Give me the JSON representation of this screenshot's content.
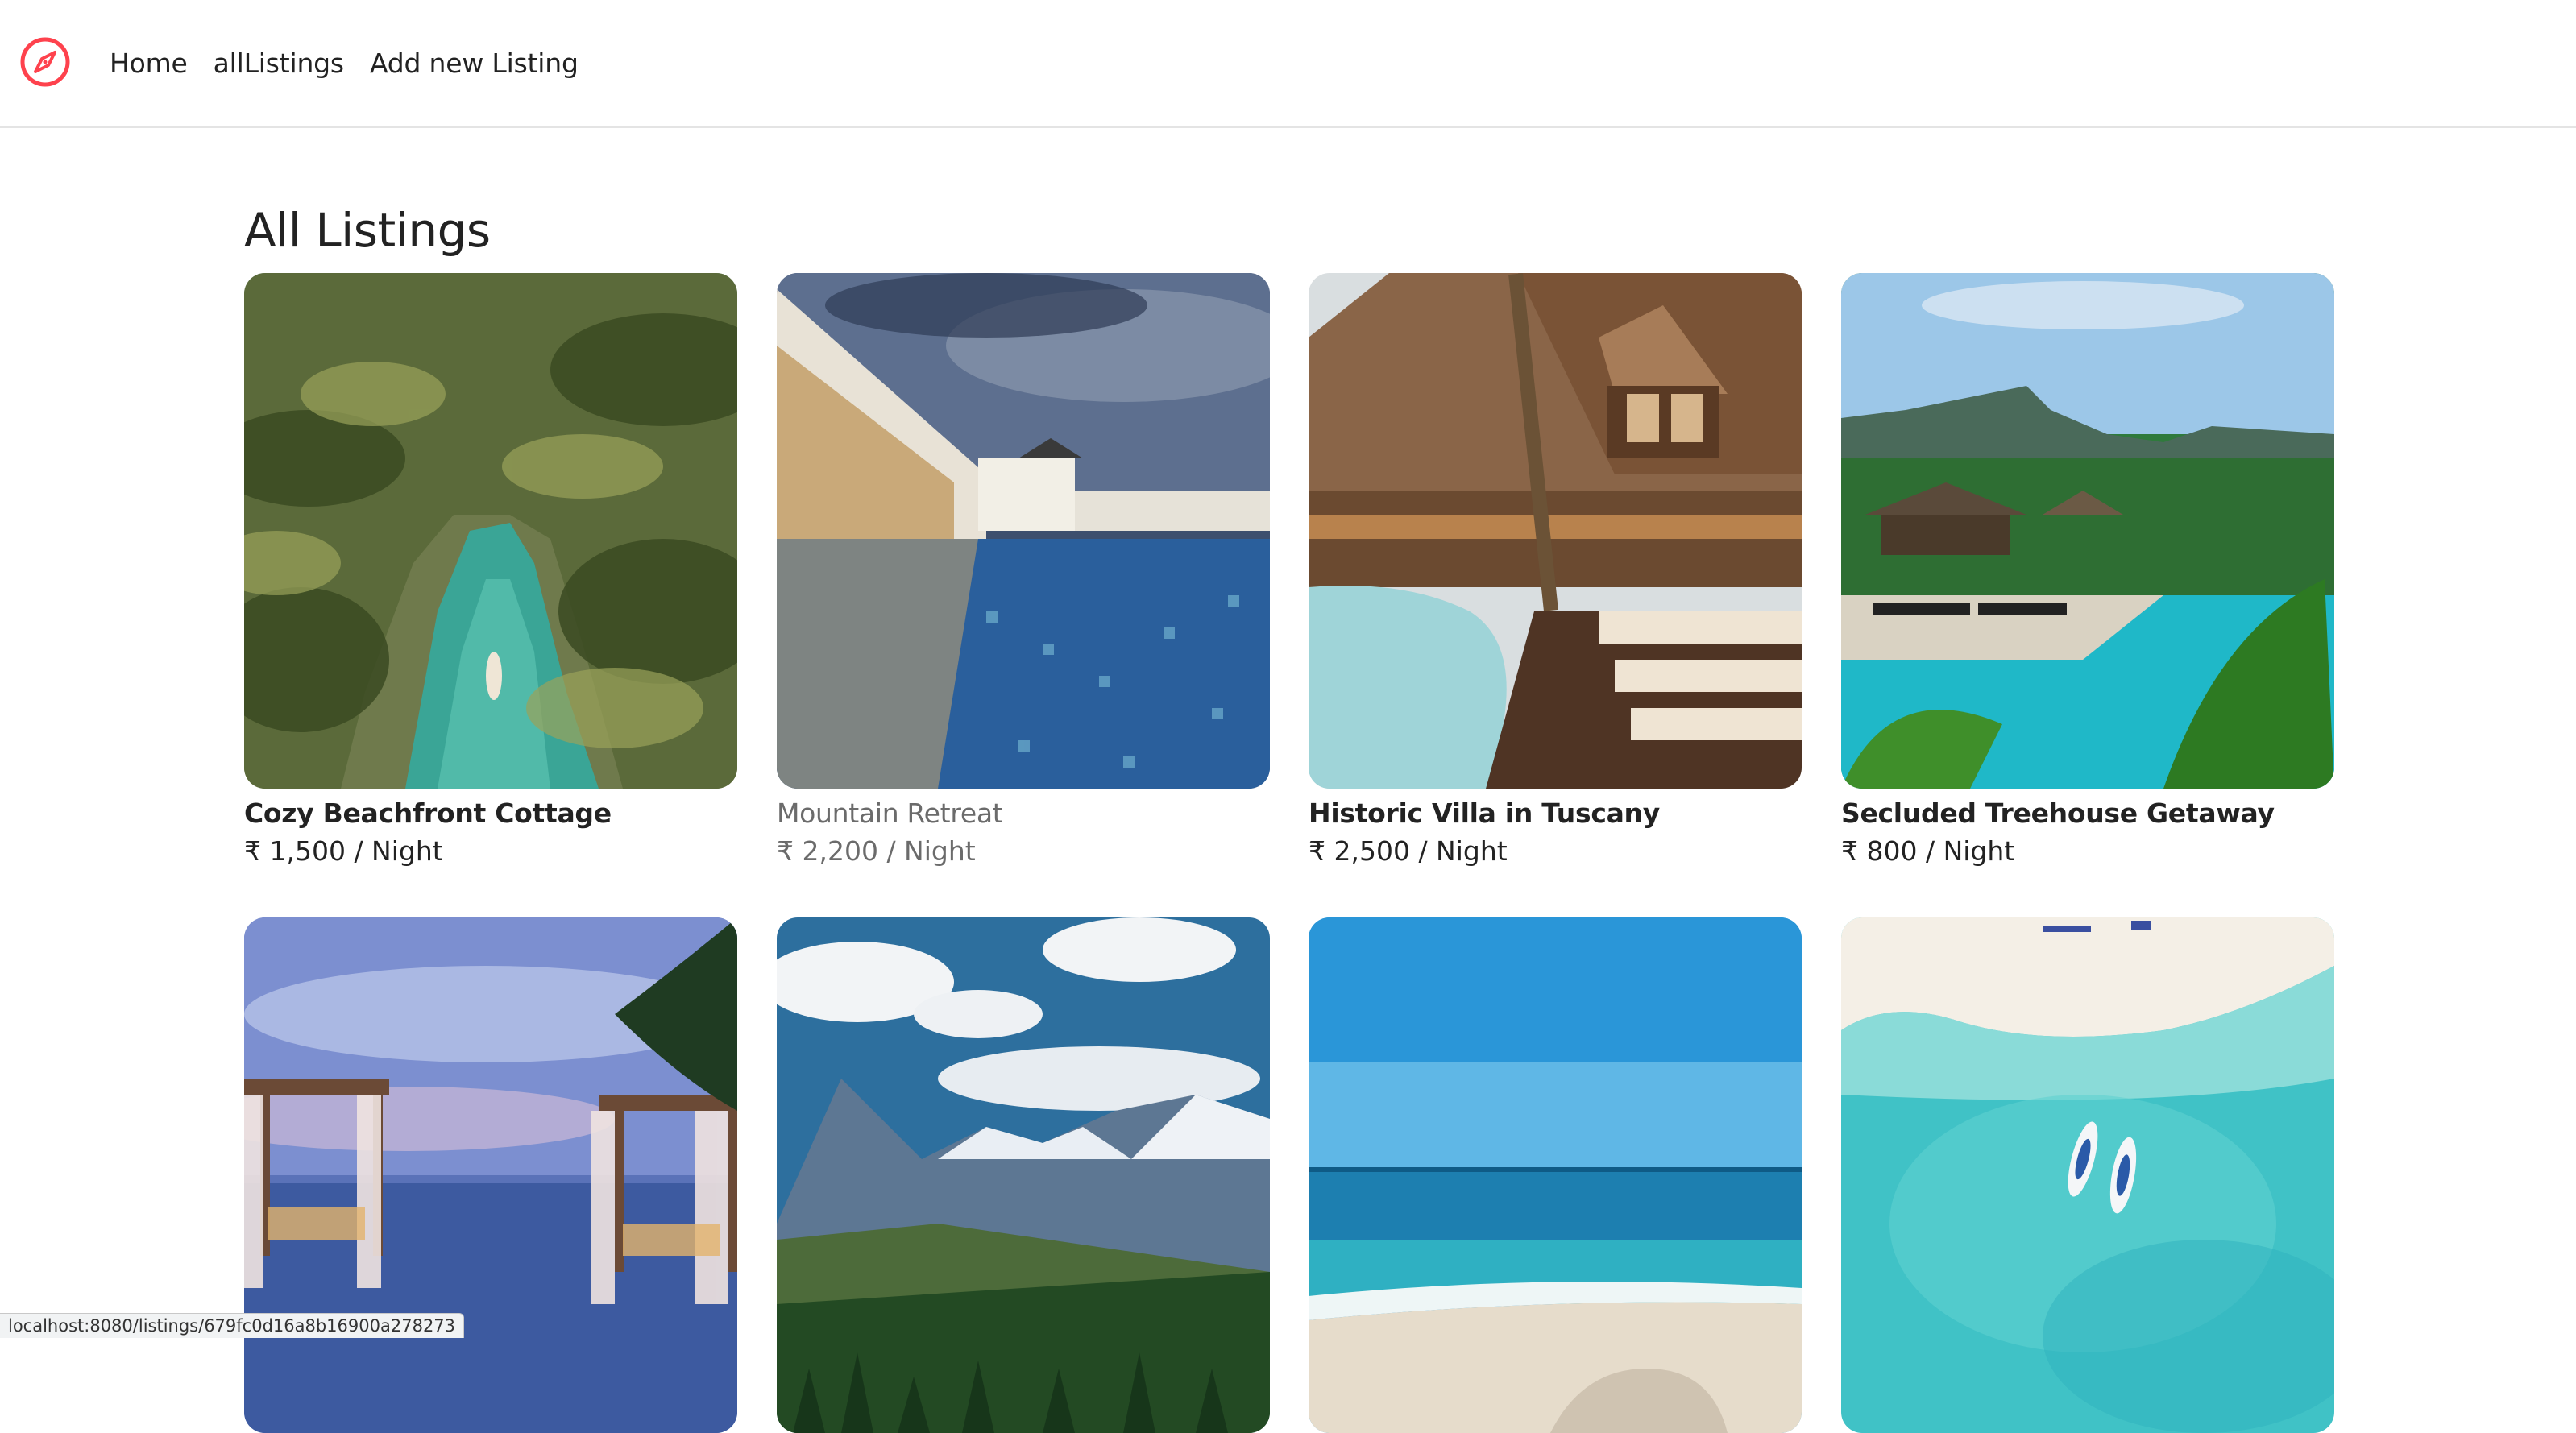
{
  "nav": {
    "logo_icon": "compass-icon",
    "brand_color": "#fe424d",
    "links": [
      "Home",
      "allListings",
      "Add new Listing"
    ]
  },
  "page": {
    "title": "All Listings"
  },
  "listings": [
    {
      "title": "Cozy Beachfront Cottage",
      "price": "₹ 1,500 / Night",
      "image": "tropical-river-with-palms"
    },
    {
      "title": "Mountain Retreat",
      "price": "₹ 2,200 / Night",
      "image": "resort-pool-at-dusk"
    },
    {
      "title": "Historic Villa in Tuscany",
      "price": "₹ 2,500 / Night",
      "image": "thatched-villa-with-pool"
    },
    {
      "title": "Secluded Treehouse Getaway",
      "price": "₹ 800 / Night",
      "image": "tropical-pool-with-mountains"
    },
    {
      "title": "",
      "price": "",
      "image": "cabanas-by-infinity-pool"
    },
    {
      "title": "",
      "price": "",
      "image": "mountain-valley"
    },
    {
      "title": "",
      "price": "",
      "image": "ocean-beach"
    },
    {
      "title": "",
      "price": "",
      "image": "aerial-turquoise-lagoon-with-boats"
    }
  ],
  "status_bar": {
    "url": "localhost:8080/listings/679fc0d16a8b16900a278273"
  }
}
